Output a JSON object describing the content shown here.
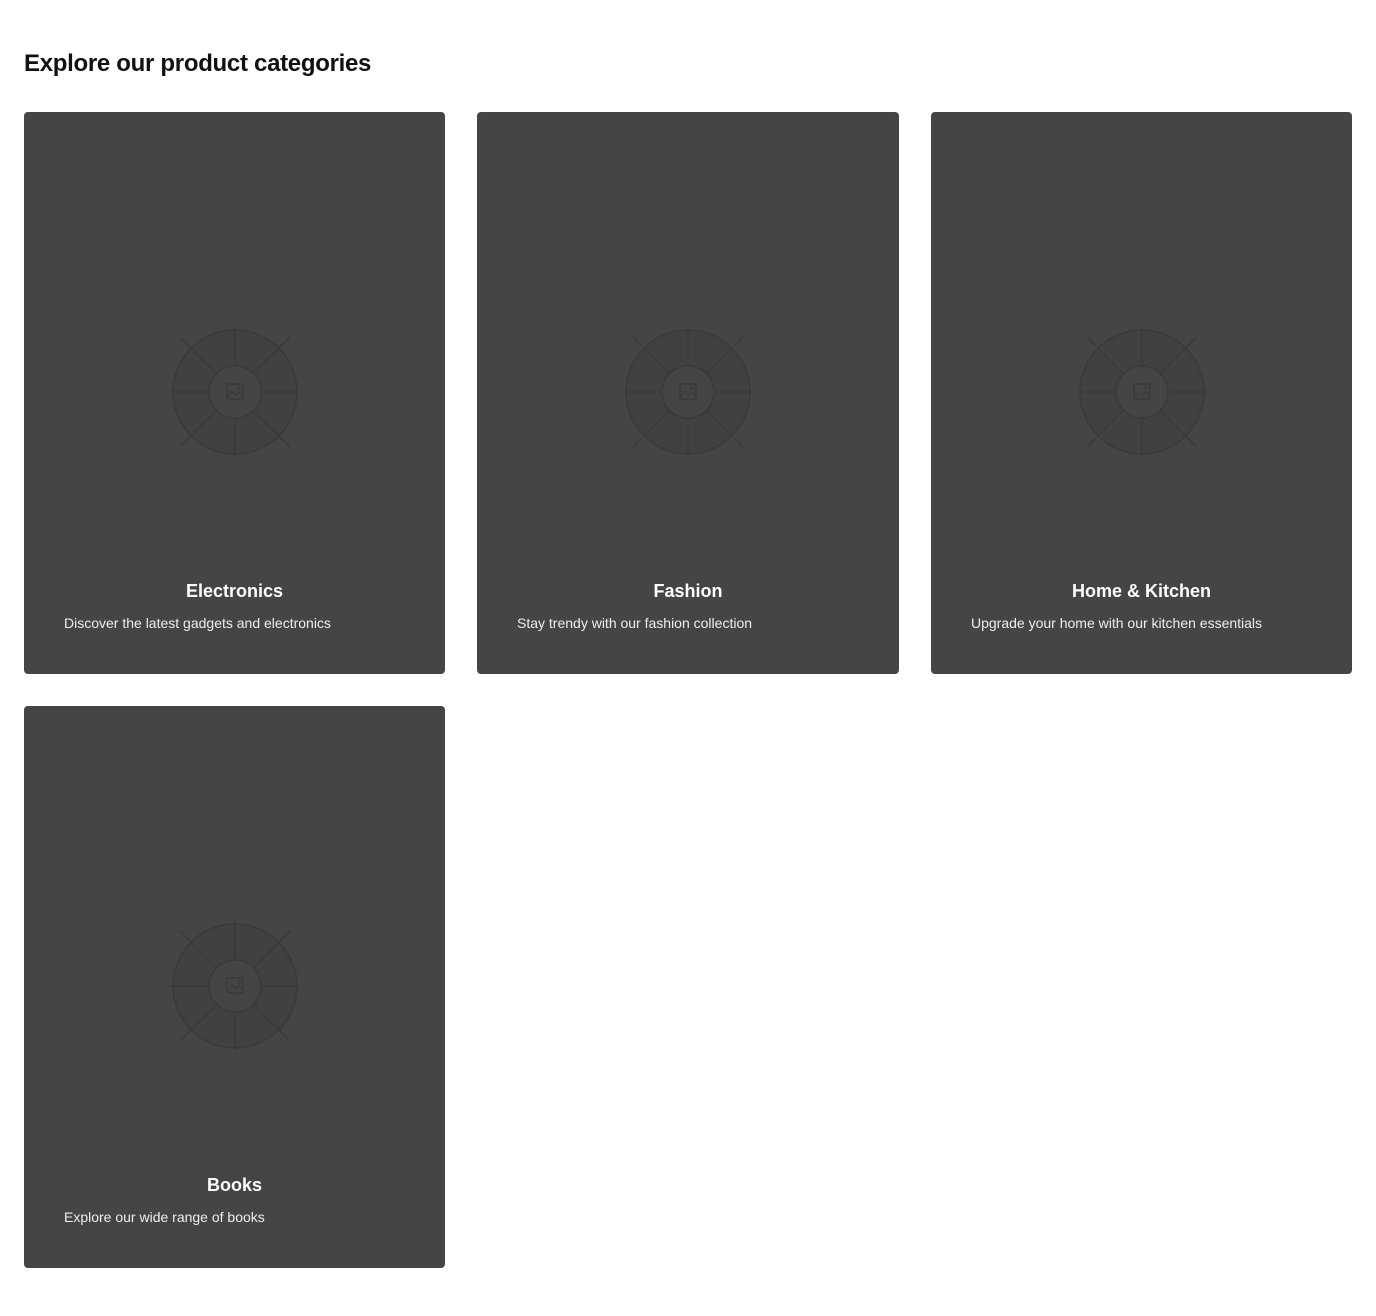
{
  "page": {
    "title": "Explore our product categories"
  },
  "colors": {
    "page_background": "#ffffff",
    "title_text": "#111111",
    "card_background": "#454545",
    "card_title": "#ffffff",
    "card_description": "#eeeeee",
    "placeholder_stroke": "#3a3a3a"
  },
  "categories": [
    {
      "name": "Electronics",
      "description": "Discover the latest gadgets and electronics",
      "image_icon": "image-placeholder-icon"
    },
    {
      "name": "Fashion",
      "description": "Stay trendy with our fashion collection",
      "image_icon": "image-placeholder-icon"
    },
    {
      "name": "Home & Kitchen",
      "description": "Upgrade your home with our kitchen essentials",
      "image_icon": "image-placeholder-icon"
    },
    {
      "name": "Books",
      "description": "Explore our wide range of books",
      "image_icon": "image-placeholder-icon"
    }
  ]
}
